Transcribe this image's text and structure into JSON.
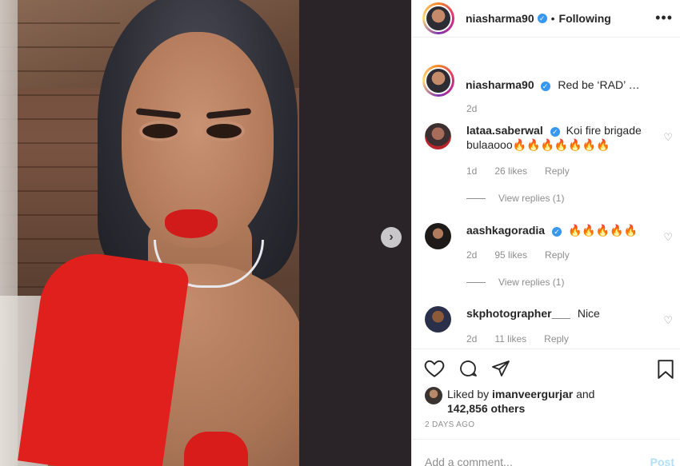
{
  "post": {
    "header": {
      "username": "niasharma90",
      "separator": "•",
      "follow_status": "Following",
      "more_label": "•••"
    },
    "caption": {
      "username": "niasharma90",
      "text": "Red be ‘RAD’ …",
      "time": "2d"
    },
    "comments": [
      {
        "username": "lataa.saberwal",
        "verified": true,
        "text": "Koi fire brigade bulaaooo🔥🔥🔥🔥🔥🔥🔥",
        "time": "1d",
        "likes": "26 likes",
        "reply": "Reply",
        "view_replies": "View replies (1)"
      },
      {
        "username": "aashkagoradia",
        "verified": true,
        "text": "🔥🔥🔥🔥🔥",
        "time": "2d",
        "likes": "95 likes",
        "reply": "Reply",
        "view_replies": "View replies (1)"
      },
      {
        "username": "skphotographer___",
        "verified": false,
        "text": "Nice",
        "time": "2d",
        "likes": "11 likes",
        "reply": "Reply"
      }
    ],
    "liked_by": {
      "prefix": "Liked by",
      "username": "imanveergurjar",
      "connector": "and",
      "others": "142,856 others"
    },
    "time_ago": "2 DAYS AGO",
    "add_comment": {
      "placeholder": "Add a comment...",
      "post_label": "Post"
    },
    "icons": {
      "like": "heart-icon",
      "comment": "comment-icon",
      "share": "paper-plane-icon",
      "save": "bookmark-icon",
      "next": "chevron-right-icon"
    },
    "colors": {
      "verified": "#3897f0",
      "muted": "#8e8e8e",
      "post_disabled": "#b2dffc"
    }
  }
}
